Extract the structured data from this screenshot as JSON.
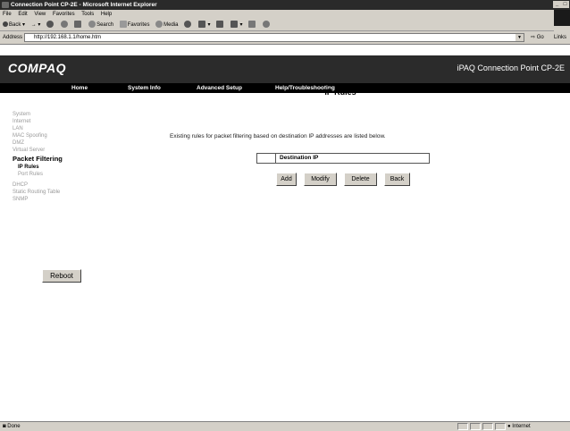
{
  "window": {
    "title": "Connection Point CP-2E  - Microsoft Internet Explorer"
  },
  "menu": [
    "File",
    "Edit",
    "View",
    "Favorites",
    "Tools",
    "Help"
  ],
  "toolbar": {
    "back": "Back",
    "search": "Search",
    "favorites": "Favorites",
    "media": "Media"
  },
  "address": {
    "label": "Address",
    "url": "http://192.168.1.1/home.htm",
    "go": "Go",
    "links": "Links"
  },
  "brand": {
    "logo": "COMPAQ",
    "product": "iPAQ Connection Point CP-2E"
  },
  "nav": [
    "Home",
    "System Info",
    "Advanced Setup",
    "Help/Troubleshooting"
  ],
  "sidebar": {
    "top_items": [
      "System",
      "Internet",
      "LAN",
      "MAC Spoofing",
      "DMZ",
      "Virtual Server"
    ],
    "section": "Packet Filtering",
    "sub_items": [
      "IP Rules",
      "Port Rules"
    ],
    "bottom_items": [
      "DHCP",
      "Static Routing Table",
      "SNMP"
    ],
    "reboot": "Reboot"
  },
  "main": {
    "title": "IP Rules",
    "description": "Existing rules for packet filtering based on destination IP addresses are listed below.",
    "table_header": "Destination IP",
    "buttons": {
      "add": "Add",
      "modify": "Modify",
      "delete": "Delete",
      "back": "Back"
    }
  },
  "status": {
    "text": "Done",
    "zone": "Internet"
  }
}
